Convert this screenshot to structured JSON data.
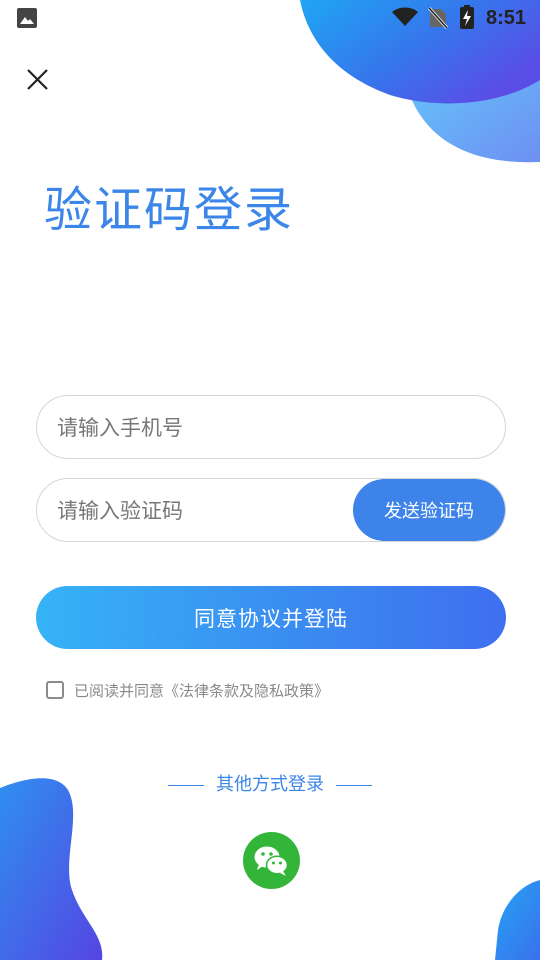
{
  "status_bar": {
    "time": "8:51",
    "icons": [
      "image-icon",
      "wifi-icon",
      "no-sim-icon",
      "battery-charging-icon"
    ]
  },
  "header": {
    "close_icon": "close-icon"
  },
  "title": "验证码登录",
  "form": {
    "phone_placeholder": "请输入手机号",
    "phone_value": "",
    "code_placeholder": "请输入验证码",
    "code_value": "",
    "send_code_label": "发送验证码",
    "login_label": "同意协议并登陆"
  },
  "agreement": {
    "checked": false,
    "text": "已阅读并同意《法律条款及隐私政策》"
  },
  "other_login": {
    "label": "其他方式登录",
    "providers": [
      "wechat-icon"
    ]
  },
  "colors": {
    "accent": "#3b86e8",
    "button_start": "#36b3f7",
    "button_end": "#3f6ff0",
    "wechat": "#33b53a"
  }
}
